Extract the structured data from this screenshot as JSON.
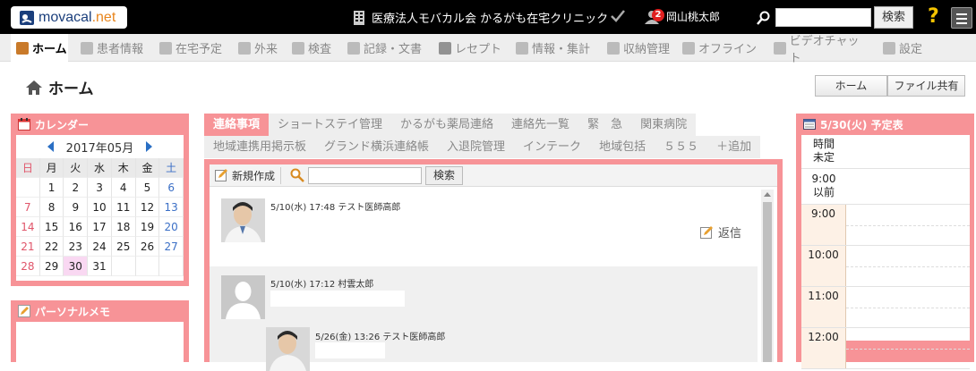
{
  "topbar": {
    "logo_main": "movacal",
    "logo_suffix": ".net",
    "clinic_name": "医療法人モバカル会 かるがも在宅クリニック",
    "notification_count": "2",
    "user_name": "岡山桃太郎",
    "search_placeholder": "",
    "search_button": "検索",
    "help_label": "?"
  },
  "nav": {
    "items": [
      {
        "label": "ホーム",
        "icon": "home-icon",
        "active": true
      },
      {
        "label": "患者情報",
        "icon": "patients-icon"
      },
      {
        "label": "在宅予定",
        "icon": "clock-icon"
      },
      {
        "label": "外来",
        "icon": "person-icon"
      },
      {
        "label": "検査",
        "icon": "chart-icon"
      },
      {
        "label": "記録・文書",
        "icon": "document-icon"
      },
      {
        "label": "レセプト",
        "icon": "receipt-icon"
      },
      {
        "label": "情報・集計",
        "icon": "stats-icon"
      },
      {
        "label": "収納管理",
        "icon": "money-icon"
      },
      {
        "label": "オフライン",
        "icon": "offline-icon"
      },
      {
        "label": "ビデオチャット",
        "icon": "tv-icon"
      },
      {
        "label": "設定",
        "icon": "gear-icon"
      }
    ]
  },
  "page": {
    "title": "ホーム",
    "buttons": [
      "ホーム",
      "ファイル共有"
    ]
  },
  "calendar": {
    "title": "カレンダー",
    "month": "2017年05月",
    "weekdays": [
      "日",
      "月",
      "火",
      "水",
      "木",
      "金",
      "土"
    ],
    "weeks": [
      [
        "",
        "1",
        "2",
        "3",
        "4",
        "5",
        "6"
      ],
      [
        "7",
        "8",
        "9",
        "10",
        "11",
        "12",
        "13"
      ],
      [
        "14",
        "15",
        "16",
        "17",
        "18",
        "19",
        "20"
      ],
      [
        "21",
        "22",
        "23",
        "24",
        "25",
        "26",
        "27"
      ],
      [
        "28",
        "29",
        "30",
        "31",
        "",
        "",
        ""
      ]
    ],
    "today": "30"
  },
  "memo": {
    "title": "パーソナルメモ"
  },
  "tabs": {
    "row1": [
      "連絡事項",
      "ショートステイ管理",
      "かるがも薬局連絡",
      "連絡先一覧",
      "緊　急",
      "関東病院"
    ],
    "row2": [
      "地域連携用掲示板",
      "グランド横浜連絡帳",
      "入退院管理",
      "インテーク",
      "地域包括",
      "５５５",
      "＋追加"
    ]
  },
  "toolbar": {
    "new_label": "新規作成",
    "search_button": "検索"
  },
  "posts": [
    {
      "meta": "5/10(水) 17:48 テスト医師高郎",
      "reply_label": "返信",
      "avatar": "doctor"
    },
    {
      "meta": "5/10(水) 17:12 村雲太郎",
      "avatar": "silhouette"
    },
    {
      "meta": "5/26(金) 13:26 テスト医師高郎",
      "avatar": "doctor"
    }
  ],
  "schedule": {
    "title": "5/30(火) 予定表",
    "untimed_label": "時間\n未定",
    "before_nine_label": "9:00\n以前",
    "hours": [
      "9:00",
      "10:00",
      "11:00",
      "12:00"
    ]
  },
  "colors": {
    "panel": "#f79397",
    "topbar": "#000000",
    "today": "#f9d8f2"
  }
}
